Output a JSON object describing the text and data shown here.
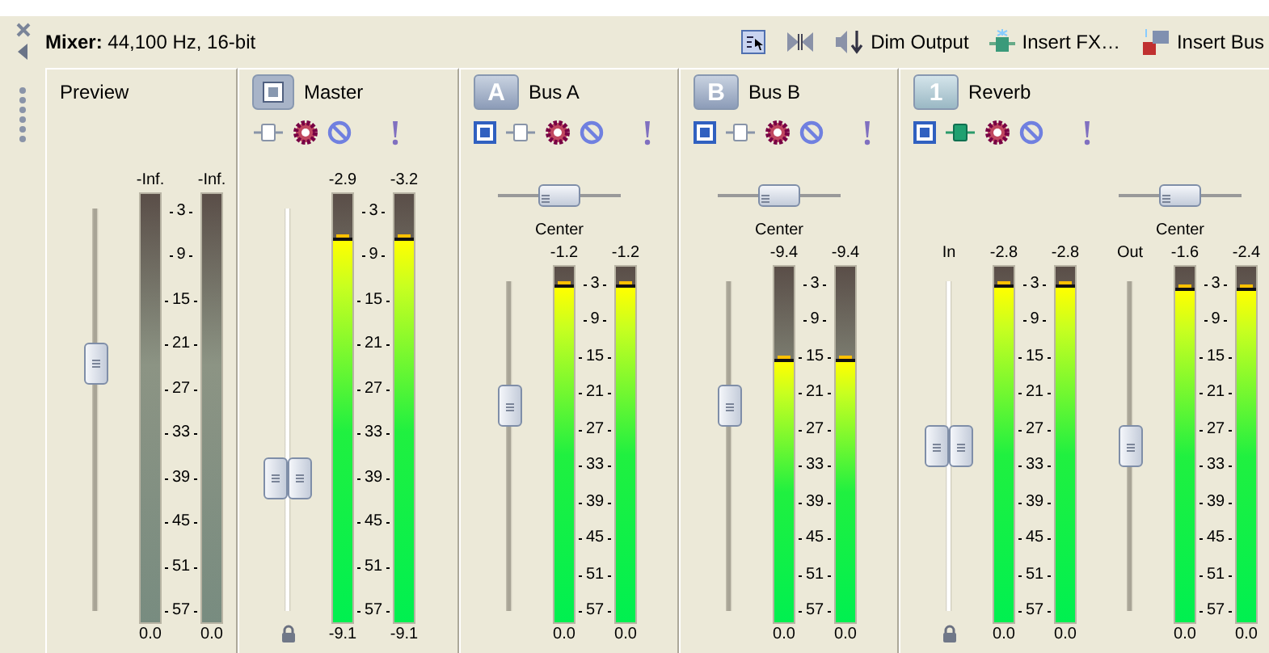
{
  "toolbar": {
    "title": "**Mixer:** 44,100 Hz, 16-bit",
    "buttons": [
      {
        "kind": "select"
      },
      {
        "kind": "bowtie"
      },
      {
        "kind": "dim",
        "label": "Dim Output"
      },
      {
        "kind": "fx",
        "label": "Insert FX…"
      },
      {
        "kind": "bus",
        "label": "Insert Bus"
      }
    ]
  },
  "strips": [
    {
      "kind": "preview",
      "name": "Preview",
      "groups": [
        {
          "fader": {
            "level": 0.63,
            "linked": false
          },
          "locked": false,
          "scale": [
            "3",
            "9",
            "15",
            "21",
            "27",
            "33",
            "39",
            "45",
            "51",
            "57"
          ],
          "meters": [
            {
              "peak": "-Inf.",
              "reading": "0.0"
            },
            {
              "peak": "-Inf.",
              "reading": "0.0"
            }
          ]
        }
      ]
    },
    {
      "kind": "master",
      "name": "Master",
      "groups": [
        {
          "fader": {
            "level": 0.31,
            "linked": true
          },
          "locked": true,
          "scale": [
            "3",
            "9",
            "15",
            "21",
            "27",
            "33",
            "39",
            "45",
            "51",
            "57"
          ],
          "meters": [
            {
              "peak": "-2.9",
              "level": 0.89,
              "reading": "-9.1"
            },
            {
              "peak": "-3.2",
              "level": 0.89,
              "reading": "-9.1"
            }
          ]
        }
      ]
    },
    {
      "kind": "bus",
      "badge": "A",
      "name": "Bus A",
      "groups": [
        {
          "pan": {
            "label": "Center",
            "level": 0.5
          },
          "fader": {
            "level": 0.64,
            "linked": false
          },
          "locked": false,
          "scale": [
            "3",
            "9",
            "15",
            "21",
            "27",
            "33",
            "39",
            "45",
            "51",
            "57"
          ],
          "meters": [
            {
              "peak": "-1.2",
              "level": 0.94,
              "reading": "0.0"
            },
            {
              "peak": "-1.2",
              "level": 0.94,
              "reading": "0.0"
            }
          ]
        }
      ]
    },
    {
      "kind": "bus",
      "badge": "B",
      "name": "Bus B",
      "groups": [
        {
          "pan": {
            "label": "Center",
            "level": 0.5
          },
          "fader": {
            "level": 0.64,
            "linked": false
          },
          "locked": false,
          "scale": [
            "3",
            "9",
            "15",
            "21",
            "27",
            "33",
            "39",
            "45",
            "51",
            "57"
          ],
          "meters": [
            {
              "peak": "-9.4",
              "level": 0.73,
              "reading": "0.0"
            },
            {
              "peak": "-9.4",
              "level": 0.73,
              "reading": "0.0"
            }
          ]
        }
      ]
    },
    {
      "kind": "fx",
      "badge": "1",
      "name": "Reverb",
      "groups": [
        {
          "label": "In",
          "fader": {
            "level": 0.5,
            "linked": true
          },
          "locked": true,
          "scale": [
            "3",
            "9",
            "15",
            "21",
            "27",
            "33",
            "39",
            "45",
            "51",
            "57"
          ],
          "meters": [
            {
              "peak": "-2.8",
              "level": 0.94,
              "reading": "0.0"
            },
            {
              "peak": "-2.8",
              "level": 0.94,
              "reading": "0.0"
            }
          ]
        },
        {
          "label": "Out",
          "pan": {
            "label": "Center",
            "level": 0.5
          },
          "fader": {
            "level": 0.5,
            "linked": false
          },
          "locked": false,
          "scale": [
            "3",
            "9",
            "15",
            "21",
            "27",
            "33",
            "39",
            "45",
            "51",
            "57"
          ],
          "meters": [
            {
              "peak": "-1.6",
              "level": 0.93,
              "reading": "0.0"
            },
            {
              "peak": "-2.4",
              "level": 0.93,
              "reading": "0.0"
            }
          ]
        }
      ]
    }
  ]
}
